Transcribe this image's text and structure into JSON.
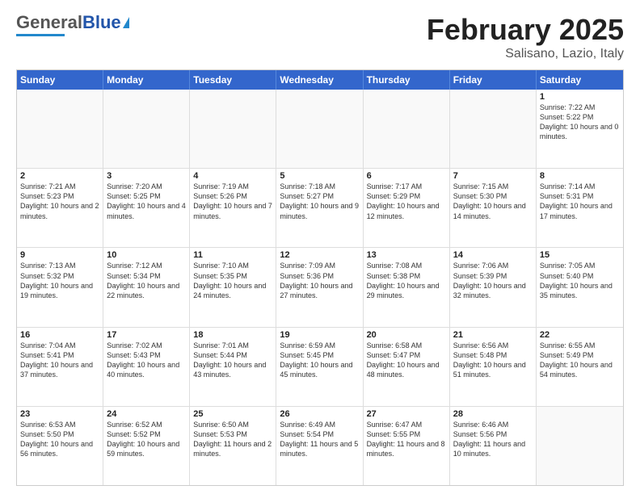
{
  "header": {
    "logo": {
      "general": "General",
      "blue": "Blue"
    },
    "title": "February 2025",
    "subtitle": "Salisano, Lazio, Italy"
  },
  "weekdays": [
    "Sunday",
    "Monday",
    "Tuesday",
    "Wednesday",
    "Thursday",
    "Friday",
    "Saturday"
  ],
  "weeks": [
    [
      {
        "day": "",
        "info": ""
      },
      {
        "day": "",
        "info": ""
      },
      {
        "day": "",
        "info": ""
      },
      {
        "day": "",
        "info": ""
      },
      {
        "day": "",
        "info": ""
      },
      {
        "day": "",
        "info": ""
      },
      {
        "day": "1",
        "info": "Sunrise: 7:22 AM\nSunset: 5:22 PM\nDaylight: 10 hours\nand 0 minutes."
      }
    ],
    [
      {
        "day": "2",
        "info": "Sunrise: 7:21 AM\nSunset: 5:23 PM\nDaylight: 10 hours\nand 2 minutes."
      },
      {
        "day": "3",
        "info": "Sunrise: 7:20 AM\nSunset: 5:25 PM\nDaylight: 10 hours\nand 4 minutes."
      },
      {
        "day": "4",
        "info": "Sunrise: 7:19 AM\nSunset: 5:26 PM\nDaylight: 10 hours\nand 7 minutes."
      },
      {
        "day": "5",
        "info": "Sunrise: 7:18 AM\nSunset: 5:27 PM\nDaylight: 10 hours\nand 9 minutes."
      },
      {
        "day": "6",
        "info": "Sunrise: 7:17 AM\nSunset: 5:29 PM\nDaylight: 10 hours\nand 12 minutes."
      },
      {
        "day": "7",
        "info": "Sunrise: 7:15 AM\nSunset: 5:30 PM\nDaylight: 10 hours\nand 14 minutes."
      },
      {
        "day": "8",
        "info": "Sunrise: 7:14 AM\nSunset: 5:31 PM\nDaylight: 10 hours\nand 17 minutes."
      }
    ],
    [
      {
        "day": "9",
        "info": "Sunrise: 7:13 AM\nSunset: 5:32 PM\nDaylight: 10 hours\nand 19 minutes."
      },
      {
        "day": "10",
        "info": "Sunrise: 7:12 AM\nSunset: 5:34 PM\nDaylight: 10 hours\nand 22 minutes."
      },
      {
        "day": "11",
        "info": "Sunrise: 7:10 AM\nSunset: 5:35 PM\nDaylight: 10 hours\nand 24 minutes."
      },
      {
        "day": "12",
        "info": "Sunrise: 7:09 AM\nSunset: 5:36 PM\nDaylight: 10 hours\nand 27 minutes."
      },
      {
        "day": "13",
        "info": "Sunrise: 7:08 AM\nSunset: 5:38 PM\nDaylight: 10 hours\nand 29 minutes."
      },
      {
        "day": "14",
        "info": "Sunrise: 7:06 AM\nSunset: 5:39 PM\nDaylight: 10 hours\nand 32 minutes."
      },
      {
        "day": "15",
        "info": "Sunrise: 7:05 AM\nSunset: 5:40 PM\nDaylight: 10 hours\nand 35 minutes."
      }
    ],
    [
      {
        "day": "16",
        "info": "Sunrise: 7:04 AM\nSunset: 5:41 PM\nDaylight: 10 hours\nand 37 minutes."
      },
      {
        "day": "17",
        "info": "Sunrise: 7:02 AM\nSunset: 5:43 PM\nDaylight: 10 hours\nand 40 minutes."
      },
      {
        "day": "18",
        "info": "Sunrise: 7:01 AM\nSunset: 5:44 PM\nDaylight: 10 hours\nand 43 minutes."
      },
      {
        "day": "19",
        "info": "Sunrise: 6:59 AM\nSunset: 5:45 PM\nDaylight: 10 hours\nand 45 minutes."
      },
      {
        "day": "20",
        "info": "Sunrise: 6:58 AM\nSunset: 5:47 PM\nDaylight: 10 hours\nand 48 minutes."
      },
      {
        "day": "21",
        "info": "Sunrise: 6:56 AM\nSunset: 5:48 PM\nDaylight: 10 hours\nand 51 minutes."
      },
      {
        "day": "22",
        "info": "Sunrise: 6:55 AM\nSunset: 5:49 PM\nDaylight: 10 hours\nand 54 minutes."
      }
    ],
    [
      {
        "day": "23",
        "info": "Sunrise: 6:53 AM\nSunset: 5:50 PM\nDaylight: 10 hours\nand 56 minutes."
      },
      {
        "day": "24",
        "info": "Sunrise: 6:52 AM\nSunset: 5:52 PM\nDaylight: 10 hours\nand 59 minutes."
      },
      {
        "day": "25",
        "info": "Sunrise: 6:50 AM\nSunset: 5:53 PM\nDaylight: 11 hours\nand 2 minutes."
      },
      {
        "day": "26",
        "info": "Sunrise: 6:49 AM\nSunset: 5:54 PM\nDaylight: 11 hours\nand 5 minutes."
      },
      {
        "day": "27",
        "info": "Sunrise: 6:47 AM\nSunset: 5:55 PM\nDaylight: 11 hours\nand 8 minutes."
      },
      {
        "day": "28",
        "info": "Sunrise: 6:46 AM\nSunset: 5:56 PM\nDaylight: 11 hours\nand 10 minutes."
      },
      {
        "day": "",
        "info": ""
      }
    ]
  ]
}
